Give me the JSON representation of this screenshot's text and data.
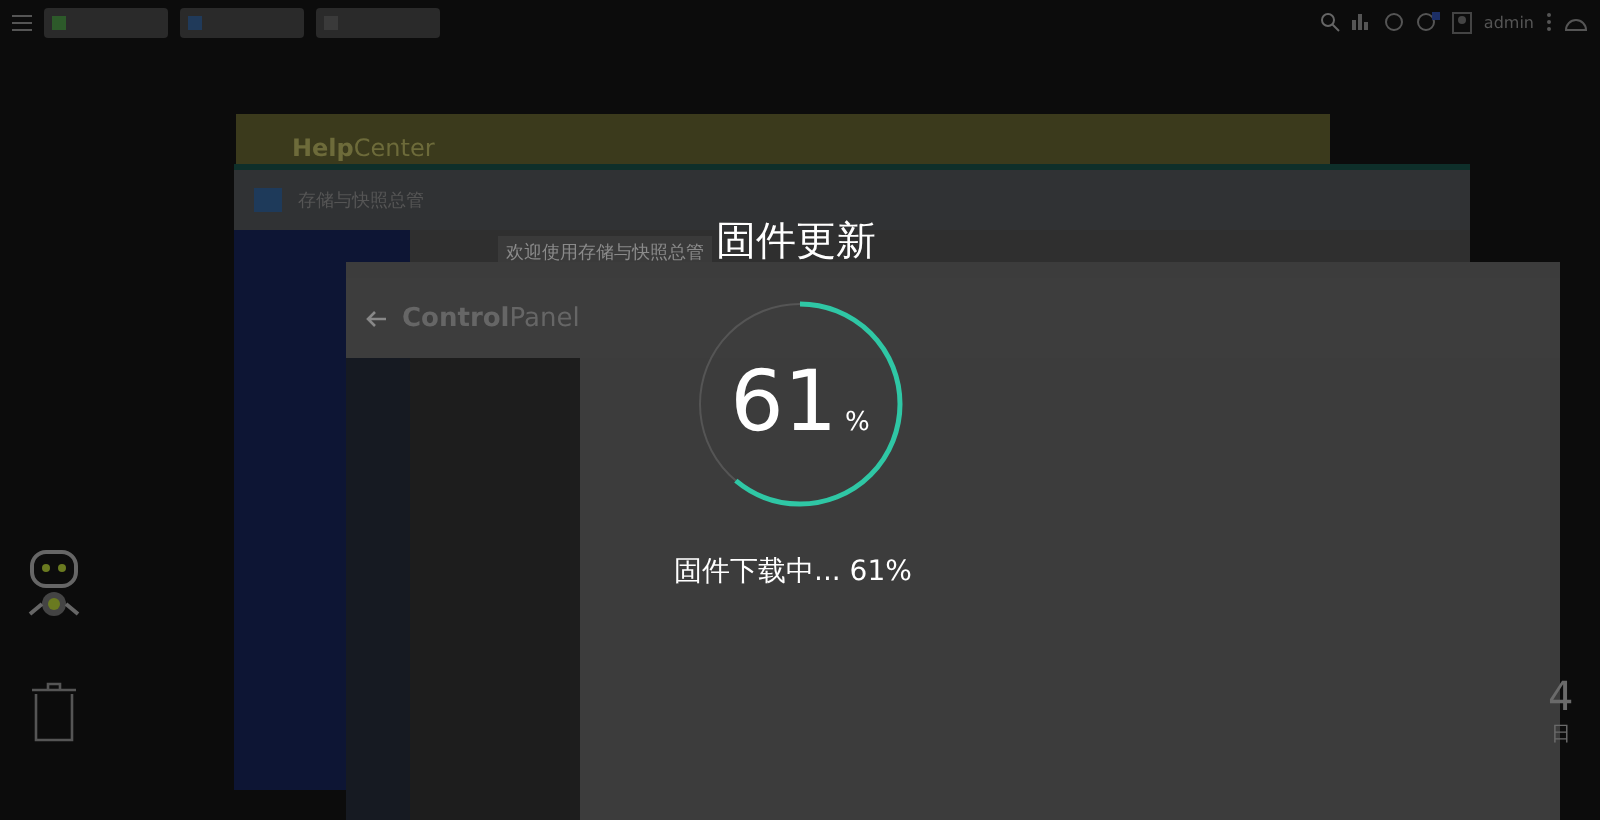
{
  "top_bar": {
    "user": "admin"
  },
  "help_center": {
    "title": "**Help**Center"
  },
  "storage_window": {
    "title": "存储与快照总管",
    "welcome": "欢迎使用存储与快照总管"
  },
  "control_panel": {
    "title": "**Control**Panel"
  },
  "desktop_clock": {
    "day": "4",
    "unit": "日"
  },
  "firmware_update": {
    "title": "固件更新",
    "percent": "61",
    "unit": "%",
    "level": 0.61,
    "status": "固件下载中... 61%"
  }
}
